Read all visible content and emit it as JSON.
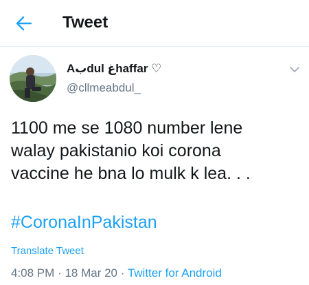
{
  "header": {
    "title": "Tweet",
    "back_icon": "arrow-left-icon"
  },
  "author": {
    "display_name": "Aبdul غhaffar ♡",
    "handle": "@cllmeabdul_"
  },
  "tweet": {
    "text_line1": "1100 me se 1080 number lene",
    "text_line2": "walay pakistanio koi corona",
    "text_line3": "vaccine he bna lo mulk k lea. . .",
    "hashtag": "#CoronaInPakistan",
    "translate_label": "Translate Tweet",
    "time": "4:08 PM",
    "separator": "·",
    "date": "18 Mar 20",
    "source": "Twitter for Android"
  },
  "colors": {
    "accent": "#1da1f2",
    "text_primary": "#14171a",
    "text_secondary": "#657786"
  }
}
